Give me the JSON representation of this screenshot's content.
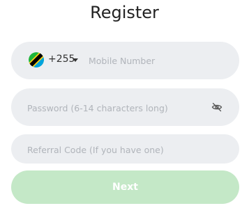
{
  "page": {
    "title": "Register"
  },
  "phone": {
    "flag_icon": "tanzania-flag-icon",
    "country_code": "+255",
    "dropdown_icon": "caret-down-icon",
    "placeholder": "Mobile Number"
  },
  "password": {
    "placeholder": "Password (6-14 characters long)",
    "toggle_icon": "eye-off-icon"
  },
  "referral": {
    "placeholder": "Referral Code (If you have one)"
  },
  "actions": {
    "next_label": "Next"
  },
  "colors": {
    "field_bg": "#eceef1",
    "next_button_bg": "#c4e8c7",
    "next_button_text": "#ffffff",
    "placeholder_text": "#b0b4ba"
  }
}
